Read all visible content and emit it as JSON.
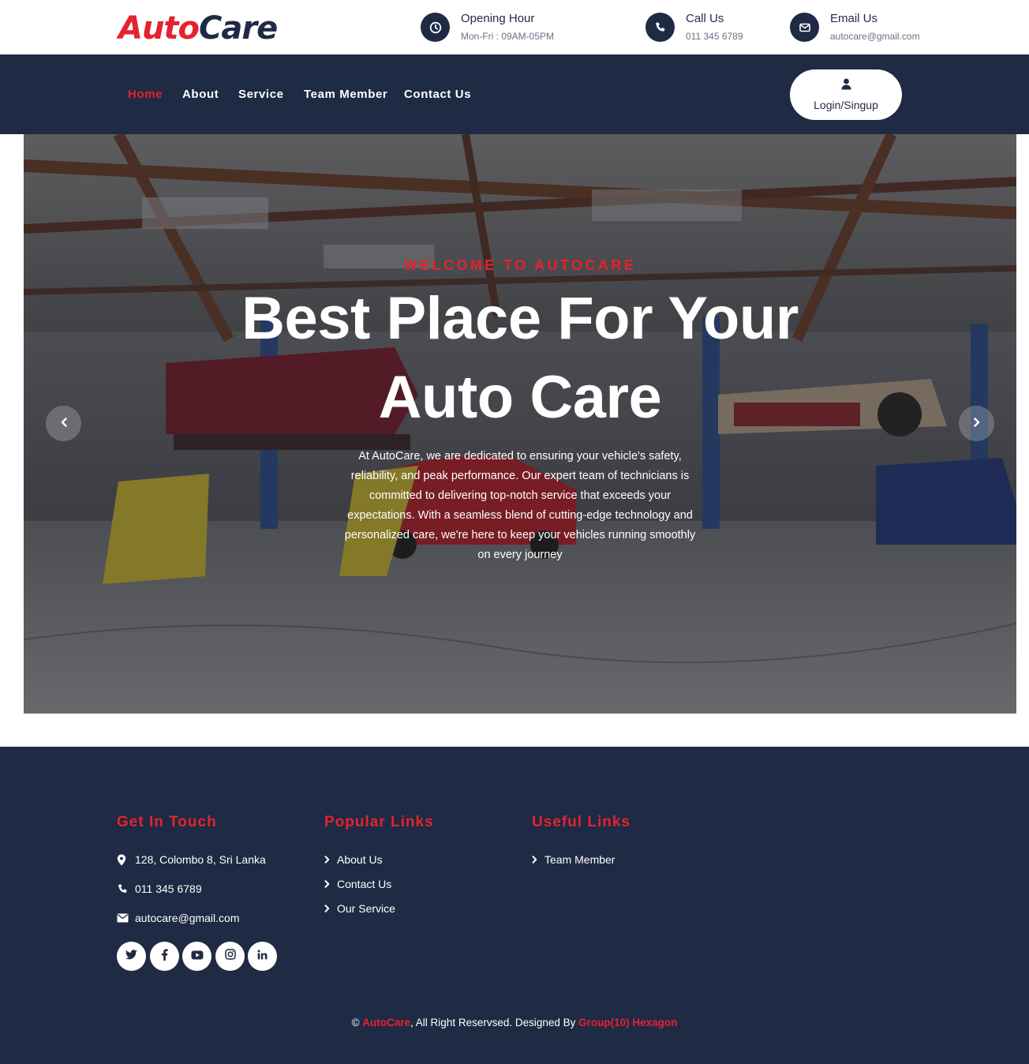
{
  "brand": {
    "part1": "Auto",
    "part2": "Care"
  },
  "topbar": {
    "opening": {
      "title": "Opening Hour",
      "value": "Mon-Fri : 09AM-05PM",
      "icon": "clock-icon"
    },
    "call": {
      "title": "Call Us",
      "value": "011 345 6789",
      "icon": "phone-icon"
    },
    "email": {
      "title": "Email Us",
      "value": "autocare@gmail.com",
      "icon": "envelope-icon"
    }
  },
  "nav": {
    "items": [
      {
        "label": "Home",
        "active": true
      },
      {
        "label": "About"
      },
      {
        "label": "Service"
      },
      {
        "label": "Team Member"
      },
      {
        "label": "Contact Us"
      }
    ],
    "login_label": "Login/Singup"
  },
  "hero": {
    "welcome": "WELCOME TO AUTOCARE",
    "title_line1": "Best Place For Your",
    "title_line2": "Auto Care",
    "description": "At AutoCare, we are dedicated to ensuring your vehicle's safety, reliability, and peak performance. Our expert team of technicians is committed to delivering top-notch service that exceeds your expectations. With a seamless blend of cutting-edge technology and personalized care, we're here to keep your vehicles running smoothly on every journey"
  },
  "footer": {
    "touch": {
      "heading": "Get In Touch",
      "address": "128, Colombo 8, Sri Lanka",
      "phone": "011 345 6789",
      "email": "autocare@gmail.com"
    },
    "popular": {
      "heading": "Popular Links",
      "links": [
        "About Us",
        "Contact Us",
        "Our Service"
      ]
    },
    "useful": {
      "heading": "Useful Links",
      "links": [
        "Team Member"
      ]
    },
    "social": [
      "twitter-icon",
      "facebook-icon",
      "youtube-icon",
      "instagram-icon",
      "linkedin-icon"
    ],
    "copyright": {
      "symbol": "©",
      "brand": "AutoCare",
      "middle": ", All Right Reservsed. Designed By ",
      "designer": "Group(10) Hexagon"
    }
  },
  "colors": {
    "navy": "#1f2a44",
    "accent": "#e5222e",
    "white": "#ffffff"
  }
}
